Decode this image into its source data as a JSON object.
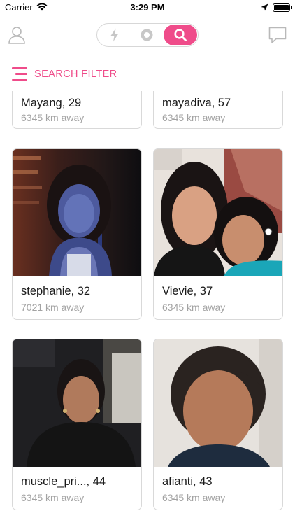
{
  "status_bar": {
    "carrier": "Carrier",
    "time": "3:29 PM"
  },
  "nav": {
    "left_icon": "user-profile-icon",
    "segments": [
      "flash-icon",
      "circle-icon",
      "search-icon"
    ],
    "active_segment": "search-icon",
    "right_icon": "chat-bubble-icon"
  },
  "filter": {
    "label": "SEARCH FILTER",
    "icon": "filter-lines-icon"
  },
  "colors": {
    "accent": "#ef4c8a",
    "border": "#d9d9d9",
    "muted_text": "#a3a3a3"
  },
  "profiles": [
    {
      "name": "Mayang, 29",
      "distance": "6345 km away"
    },
    {
      "name": "mayadiva, 57",
      "distance": "6345 km away"
    },
    {
      "name": "stephanie, 32",
      "distance": "7021 km away"
    },
    {
      "name": "Vievie, 37",
      "distance": "6345 km away"
    },
    {
      "name": "muscle_pri..., 44",
      "distance": "6345 km away"
    },
    {
      "name": "afianti, 43",
      "distance": "6345 km away"
    }
  ]
}
